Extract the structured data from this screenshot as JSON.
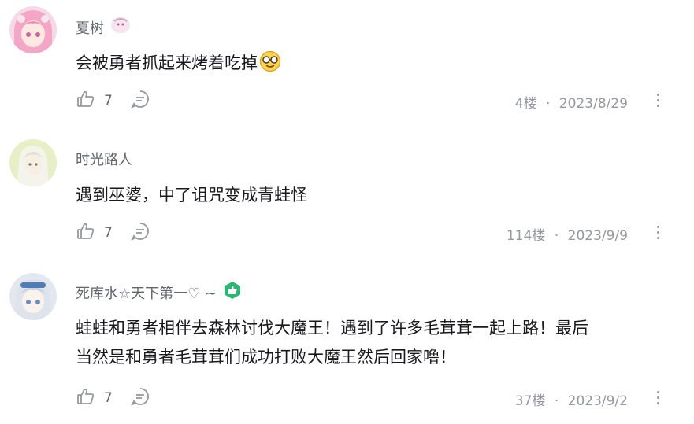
{
  "comments": [
    {
      "username": "夏树",
      "content": "会被勇者抓起来烤着吃掉",
      "likes": "7",
      "floor": "4楼",
      "date": "2023/8/29",
      "separator": "·"
    },
    {
      "username": "时光路人",
      "content": "遇到巫婆，中了诅咒变成青蛙怪",
      "likes": "7",
      "floor": "114楼",
      "date": "2023/9/9",
      "separator": "·"
    },
    {
      "username": "死库水☆天下第一♡ ~",
      "content_line1": "蛙蛙和勇者相伴去森林讨伐大魔王！遇到了许多毛茸茸一起上路！最后",
      "content_line2": "当然是和勇者毛茸茸们成功打败大魔王然后回家噜！",
      "likes": "7",
      "floor": "37楼",
      "date": "2023/9/2",
      "separator": "·"
    }
  ],
  "icons": {
    "like": "thumbs-up-icon",
    "reply": "reply-bubble-icon",
    "more": "more-vertical-icon",
    "emoji": "sunglasses-emoji-icon",
    "badge": "green-hexagon-badge-icon"
  },
  "colors": {
    "text": "#18191c",
    "secondary": "#61666d",
    "muted": "#9499a0",
    "badge": "#2bb673"
  }
}
